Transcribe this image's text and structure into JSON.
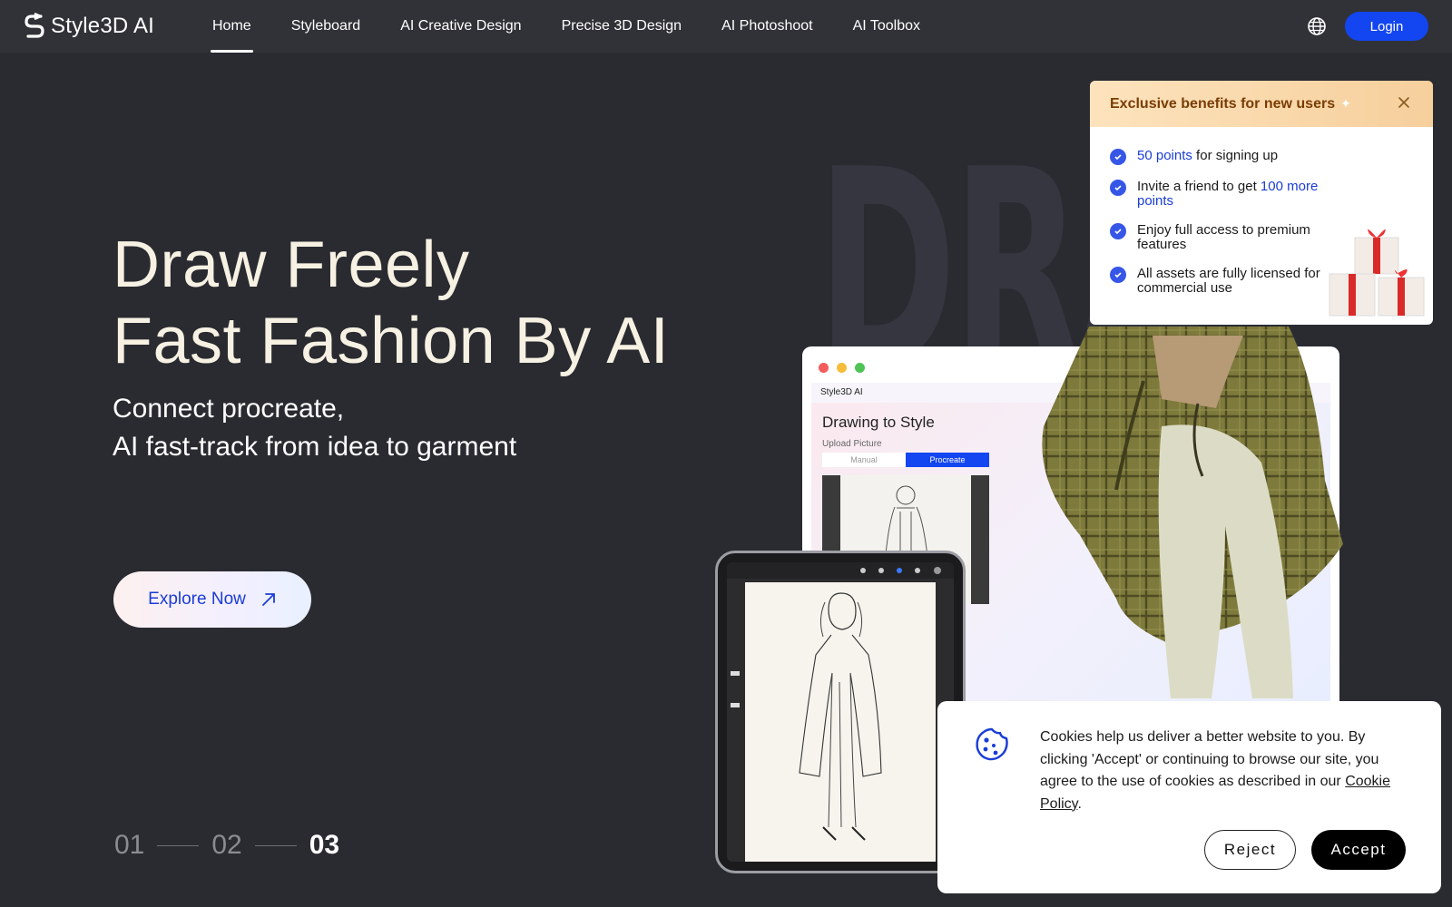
{
  "header": {
    "brand": "Style3D AI",
    "nav": [
      {
        "label": "Home",
        "active": true
      },
      {
        "label": "Styleboard"
      },
      {
        "label": "AI Creative Design"
      },
      {
        "label": "Precise 3D Design"
      },
      {
        "label": "AI Photoshoot"
      },
      {
        "label": "AI Toolbox"
      }
    ],
    "login_label": "Login",
    "accent": "#1345f0"
  },
  "hero": {
    "bg_letters": "DRA",
    "title_line1": "Draw Freely",
    "title_line2": "Fast Fashion By AI",
    "subtitle_line1": "Connect procreate,",
    "subtitle_line2": "AI fast-track from idea to garment",
    "cta_label": "Explore Now",
    "steps": [
      "01",
      "02",
      "03"
    ],
    "current_step": "03"
  },
  "mockup": {
    "brand": "Style3D AI",
    "heading": "Drawing to Style",
    "upload_label": "Upload Picture",
    "tabs": [
      "Manual",
      "Procreate"
    ],
    "active_tab": "Procreate"
  },
  "benefits": {
    "title": "Exclusive benefits for new users",
    "item1_highlight": "50 points",
    "item1_rest": " for signing up",
    "item2_text": "Invite a friend to get ",
    "item2_highlight": "100 more points",
    "item3_text": "Enjoy full access to premium features",
    "item4_text": "All assets are fully licensed for commercial use"
  },
  "cookie": {
    "text": "Cookies help us deliver a better website to you. By clicking 'Accept' or continuing to browse our site, you agree to the use of cookies as described in our ",
    "link_label": "Cookie Policy",
    "trailing": ".",
    "reject_label": "Reject",
    "accept_label": "Accept"
  }
}
